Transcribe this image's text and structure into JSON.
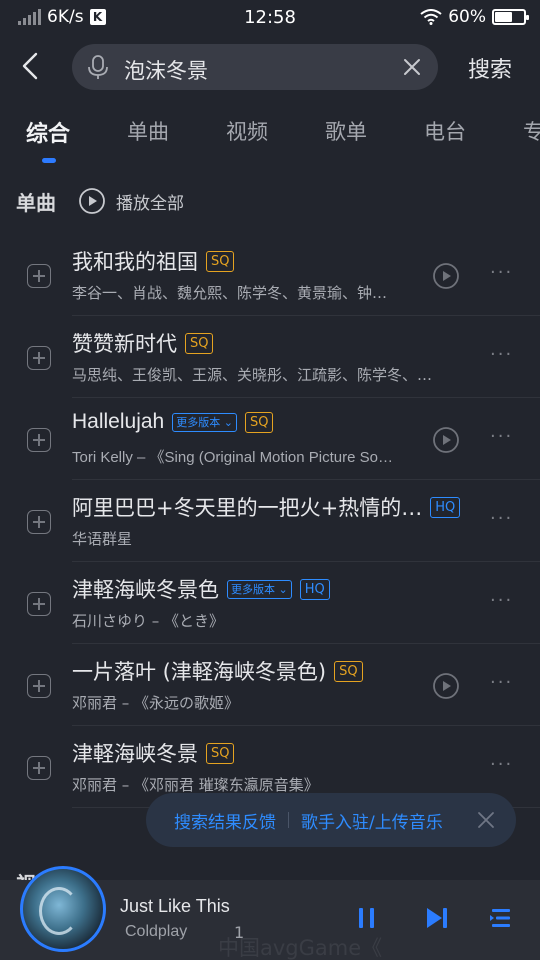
{
  "status": {
    "net_speed": "6K/s",
    "time": "12:58",
    "battery": "60%",
    "battery_level": 0.6
  },
  "search": {
    "query": "泡沫冬景",
    "button": "搜索"
  },
  "tabs": [
    {
      "label": "综合",
      "active": true
    },
    {
      "label": "单曲"
    },
    {
      "label": "视频"
    },
    {
      "label": "歌单"
    },
    {
      "label": "电台"
    },
    {
      "label": "专"
    }
  ],
  "section": {
    "title": "单曲",
    "play_all": "播放全部"
  },
  "songs": [
    {
      "title": "我和我的祖国",
      "subtitle": "李谷一、肖战、魏允熙、陈学冬、黄景瑜、钟…",
      "badge": "SQ",
      "mv": true
    },
    {
      "title": "赞赞新时代",
      "subtitle": "马思纯、王俊凯、王源、关晓彤、江疏影、陈学冬、…",
      "badge": "SQ",
      "mv": false
    },
    {
      "title": "Hallelujah",
      "more_versions": "更多版本",
      "subtitle": "Tori Kelly – 《Sing (Original Motion Picture So…",
      "badge": "SQ",
      "mv": true
    },
    {
      "title": "阿里巴巴+冬天里的一把火+热情的…",
      "subtitle": "华语群星",
      "badge": "HQ",
      "mv": false
    },
    {
      "title": "津軽海峡冬景色",
      "more_versions": "更多版本",
      "subtitle": "石川さゆり – 《とき》",
      "badge": "HQ",
      "mv": false
    },
    {
      "title": "一片落叶 (津軽海峡冬景色)",
      "subtitle": "邓丽君 – 《永远の歌姬》",
      "badge": "SQ",
      "mv": true
    },
    {
      "title": "津軽海峡冬景",
      "subtitle": "邓丽君 – 《邓丽君 璀璨东瀛原音集》",
      "badge": "SQ",
      "mv": false
    }
  ],
  "feedback": {
    "link1": "搜索结果反馈",
    "link2": "歌手入驻/上传音乐"
  },
  "peek_title": "视",
  "player": {
    "title": "Just Like This",
    "artist": "Coldplay",
    "count": "1",
    "lyric": "中国avgGame《"
  },
  "colors": {
    "accent": "#2d7bff",
    "sq": "#e5a321",
    "hq": "#2e8cff"
  }
}
